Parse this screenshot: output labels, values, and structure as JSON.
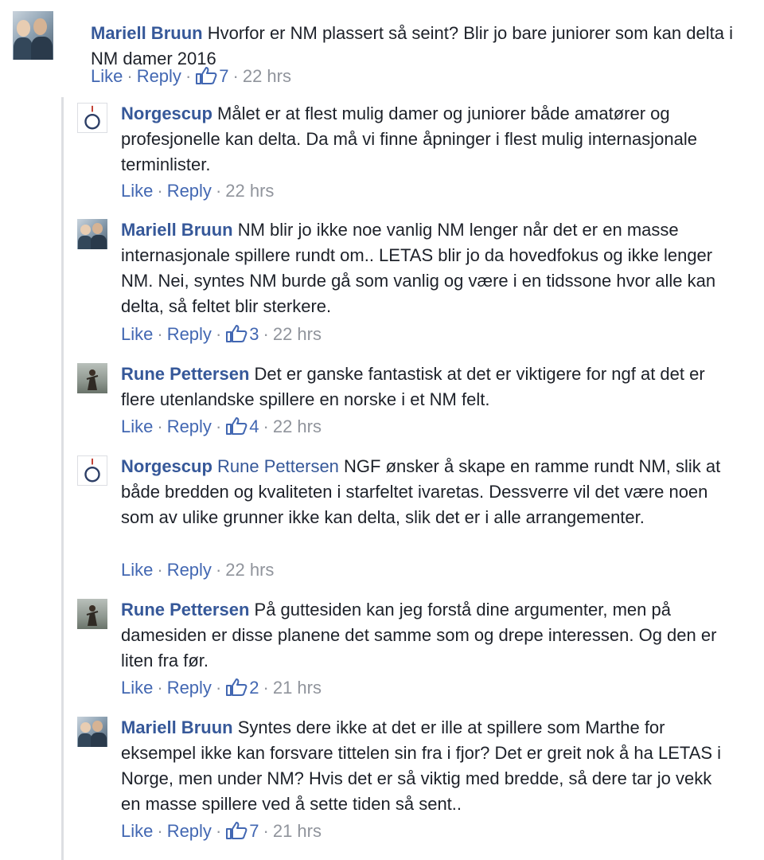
{
  "comments": [
    {
      "author": "Mariell Bruun",
      "tagged": "",
      "text": "Hvorfor er NM plassert så seint? Blir jo bare juniorer som kan delta i NM damer 2016",
      "like_label": "Like",
      "reply_label": "Reply",
      "likes": "7",
      "time": "22 hrs",
      "avatar": "mariell-photo"
    },
    {
      "author": "Norgescup",
      "tagged": "",
      "text": "Målet er at flest mulig damer og juniorer både amatører og profesjonelle kan delta. Da må vi finne åpninger i flest mulig internasjonale terminlister.",
      "like_label": "Like",
      "reply_label": "Reply",
      "likes": "",
      "time": "22 hrs",
      "avatar": "norgescup-logo"
    },
    {
      "author": "Mariell Bruun",
      "tagged": "",
      "text": "NM blir jo ikke noe vanlig NM lenger når det er en masse internasjonale spillere rundt om.. LETAS blir jo da hovedfokus og ikke lenger NM. Nei, syntes NM burde gå som vanlig og være i en tidssone hvor alle kan delta, så feltet blir sterkere.",
      "like_label": "Like",
      "reply_label": "Reply",
      "likes": "3",
      "time": "22 hrs",
      "avatar": "mariell-photo"
    },
    {
      "author": "Rune Pettersen",
      "tagged": "",
      "text": "Det er ganske fantastisk at det er viktigere for ngf at det er flere utenlandske spillere en norske i et NM felt.",
      "like_label": "Like",
      "reply_label": "Reply",
      "likes": "4",
      "time": "22 hrs",
      "avatar": "rune-photo"
    },
    {
      "author": "Norgescup",
      "tagged": "Rune Pettersen",
      "text": "NGF ønsker å skape en ramme rundt NM, slik at både bredden og kvaliteten i starfeltet ivaretas. Dessverre vil det være noen som av ulike grunner ikke kan delta, slik det er i alle arrangementer.",
      "like_label": "Like",
      "reply_label": "Reply",
      "likes": "",
      "time": "22 hrs",
      "avatar": "norgescup-logo"
    },
    {
      "author": "Rune Pettersen",
      "tagged": "",
      "text": "På guttesiden kan jeg forstå dine argumenter, men på damesiden er disse planene det samme som og drepe interessen. Og den er liten fra før.",
      "like_label": "Like",
      "reply_label": "Reply",
      "likes": "2",
      "time": "21 hrs",
      "avatar": "rune-photo"
    },
    {
      "author": "Mariell Bruun",
      "tagged": "",
      "text": "Syntes dere ikke at det er ille at spillere som Marthe for eksempel ikke kan forsvare tittelen sin fra i fjor? Det er greit nok å ha LETAS i Norge, men under NM? Hvis det er så viktig med bredde, så dere tar jo vekk en masse spillere ved å sette tiden så sent..",
      "like_label": "Like",
      "reply_label": "Reply",
      "likes": "7",
      "time": "21 hrs",
      "avatar": "mariell-photo"
    }
  ],
  "colors": {
    "link": "#365899",
    "action_link": "#4267b2",
    "meta": "#90949c",
    "text": "#1d2129",
    "thread_line": "#dddfe2"
  }
}
